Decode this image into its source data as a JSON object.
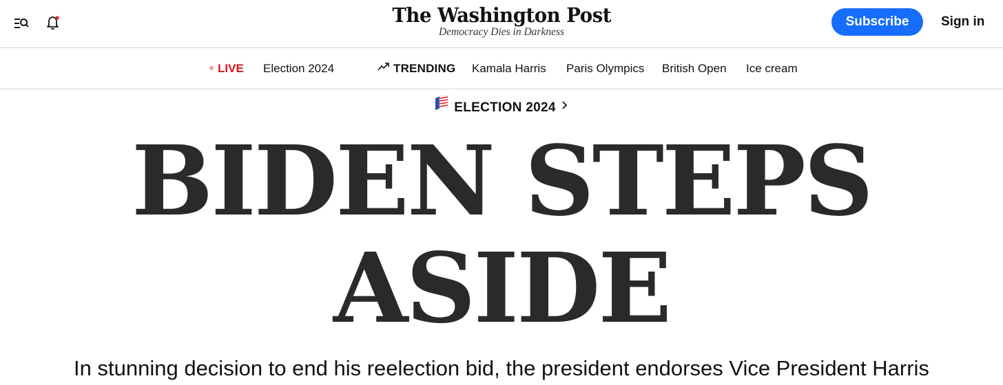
{
  "header": {
    "logo_text": "The Washington Post",
    "tagline": "Democracy Dies in Darkness",
    "subscribe_label": "Subscribe",
    "signin_label": "Sign in",
    "menu_icon": "menu-search-icon",
    "notifications_icon": "bell-icon",
    "accent_color": "#166dfc"
  },
  "nav": {
    "live_label": "LIVE",
    "live_color": "#d8141c",
    "live_link": "Election 2024",
    "trending_label": "TRENDING",
    "trending_icon": "trending-up-icon",
    "trending_items": [
      "Kamala Harris",
      "Paris Olympics",
      "British Open",
      "Ice cream"
    ]
  },
  "article": {
    "kicker": "ELECTION 2024",
    "kicker_icon": "ballot-flag-icon",
    "headline_line1": "BIDEN STEPS",
    "headline_line2": "ASIDE",
    "dek": "In stunning decision to end his reelection bid, the president endorses Vice President Harris"
  }
}
